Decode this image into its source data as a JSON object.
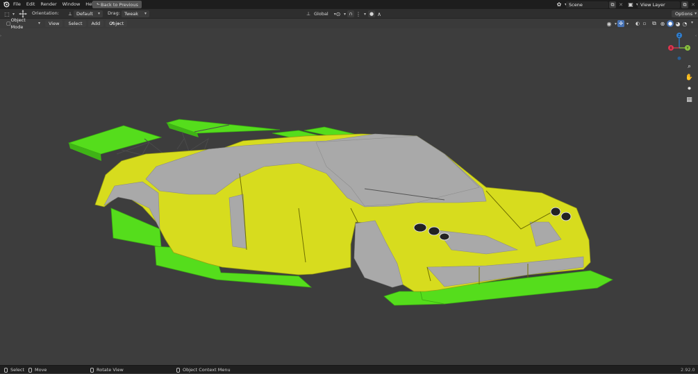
{
  "topbar": {
    "menus": [
      "File",
      "Edit",
      "Render",
      "Window",
      "Help"
    ],
    "back_button": "Back to Previous",
    "scene": "Scene",
    "view_layer": "View Layer"
  },
  "tool_header": {
    "orientation_label": "Orientation:",
    "orientation_value": "Default",
    "drag_label": "Drag:",
    "drag_value": "Tweak",
    "transform_orientation": "Global",
    "options": "Options"
  },
  "view_header": {
    "mode": "Object Mode",
    "menus": [
      "View",
      "Select",
      "Add",
      "Object"
    ]
  },
  "gizmo": {
    "axes": [
      "X",
      "Y",
      "Z"
    ],
    "colors": {
      "x": "#e0354f",
      "y": "#8bc43f",
      "z": "#2f7fd1"
    }
  },
  "model_colors": {
    "yellow": "#d7dc1e",
    "green": "#55dd1c",
    "gray": "#a9a9a9"
  },
  "statusbar": {
    "select": "Select",
    "move": "Move",
    "rotate": "Rotate View",
    "context": "Object Context Menu",
    "version": "2.92.0"
  }
}
